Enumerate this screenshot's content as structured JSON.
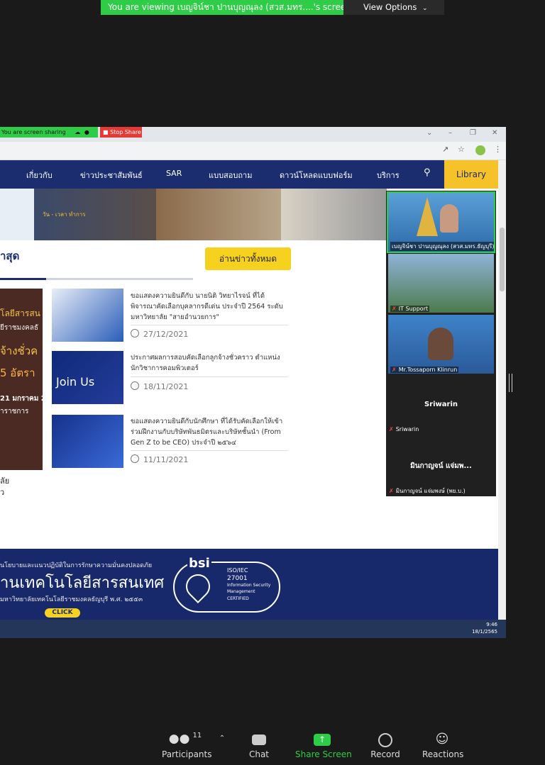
{
  "banner": {
    "viewing_text": "You are viewing เบญจิน์ชา ปานบุญณุลง (สวส.มทร....'s screen",
    "view_options": "View Options"
  },
  "sharebar": {
    "sharing_text": "You are screen sharing",
    "stop_share": "Stop Share"
  },
  "nav": {
    "items": [
      "เกี่ยวกับ",
      "ข่าวประชาสัมพันธ์",
      "SAR",
      "แบบสอบถาม",
      "ดาวน์โหลดแบบฟอร์ม",
      "บริการ"
    ],
    "library": "Library"
  },
  "banner_images": {
    "date_caption": "วัน - เวลา ทำการ"
  },
  "news_section": {
    "heading": "าสุด",
    "all_news_button": "อ่านข่าวทั้งหมด",
    "items": [
      {
        "title": "ขอแสดงความยินดีกับ นายนิติ วิทยาไรจน์ ที่ได้พิจารณาคัดเลือกบุคลากรดีเด่น ประจำปี 2564 ระดับมหาวิทยาลัย \"สายอำนวยการ\"",
        "date": "27/12/2021"
      },
      {
        "title": "ประกาศผลการสอบคัดเลือกลูกจ้างชั่วคราว ตำแหน่ง นักวิชาการคอมพิวเตอร์",
        "date": "18/11/2021"
      },
      {
        "title": "ขอแสดงความยินดีกับนักศึกษา ที่ได้รับคัดเลือกให้เข้าร่วมฝึกงานกับบริษัทพันธมิตรและบริษัทชั้นนำ (From Gen Z to be CEO) ประจำปี ๒๕๖๔",
        "date": "11/11/2021"
      }
    ],
    "thumb2_text": "Join Us"
  },
  "poster": {
    "line1": "โลยีสารสน",
    "line2": "ยีราชมงคลธั",
    "line3": "จ้างชั่วค",
    "line4": "5 อัตรา",
    "line5": "21 มกราคม 2",
    "line6": "าราชการ",
    "foot1": "ลัย",
    "foot2": "ว"
  },
  "footer": {
    "policy_text": "นโยบายและแนวปฏิบัติในการรักษาความมั่นคงปลอดภัย",
    "center_text": "านเทคโนโลยีสารสนเทศ",
    "univ_text": "มหาวิทยาลัยเทคโนโลยีราชมงคลธัญบุรี พ.ศ. ๒๕๕๓",
    "click": "CLICK",
    "bsi": "bsi",
    "iso": "ISO/IEC",
    "iso_num": "27001",
    "iso_desc1": "Information Security",
    "iso_desc2": "Management",
    "iso_desc3": "CERTIFIED"
  },
  "taskbar": {
    "time": "9:46",
    "date": "18/1/2565"
  },
  "gallery": {
    "tiles": [
      {
        "name": "เบญจิน์ชา ปานบุญณุลง (สวส.มทร.ธัญบุรี)"
      },
      {
        "name": "IT Support"
      },
      {
        "name": "Mr.Tossaporn Klinrun"
      }
    ],
    "blank1": {
      "name": "Sriwarin",
      "label": "Sriwarin"
    },
    "blank2": {
      "name": "มินกาญจน์ แจ่มพ...",
      "label": "มินกาญจน์ แจ่มพงษ์ (พย.บ.)"
    }
  },
  "toolbar": {
    "participants_label": "Participants",
    "participants_count": "11",
    "chat_label": "Chat",
    "share_label": "Share Screen",
    "record_label": "Record",
    "reactions_label": "Reactions"
  },
  "colors": {
    "zoom_green": "#2ecc47",
    "site_navy": "#1b2d6e",
    "site_yellow": "#f6c22a",
    "stop_red": "#e53935"
  }
}
